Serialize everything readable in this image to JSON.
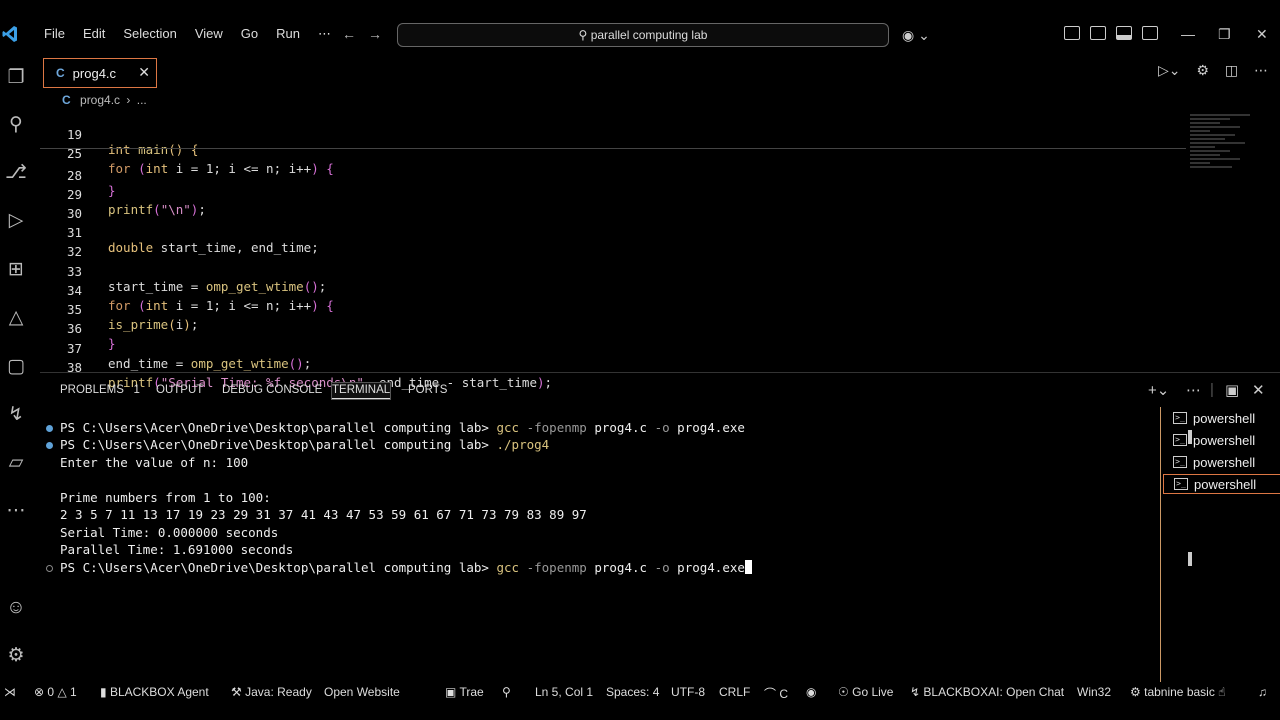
{
  "titlebar": {
    "menus": [
      "File",
      "Edit",
      "Selection",
      "View",
      "Go",
      "Run",
      "⋯"
    ],
    "search": "parallel computing lab",
    "copilot_icon": "copilot-icon"
  },
  "editor": {
    "tab": {
      "lang": "C",
      "name": "prog4.c",
      "close": "✕"
    },
    "breadcrumb": {
      "lang": "C",
      "file": "prog4.c",
      "sep": "›",
      "more": "..."
    },
    "lines": [
      {
        "num": "19",
        "text": "int main() {"
      },
      {
        "num": "25",
        "text": "for (int i = 1; i <= n; i++) {"
      },
      {
        "num": "28",
        "text": "}"
      },
      {
        "num": "29",
        "text": "printf(\"\\n\");"
      },
      {
        "num": "30",
        "text": ""
      },
      {
        "num": "31",
        "text": "double start_time, end_time;"
      },
      {
        "num": "32",
        "text": ""
      },
      {
        "num": "33",
        "text": "start_time = omp_get_wtime();"
      },
      {
        "num": "34",
        "text": "for (int i = 1; i <= n; i++) {"
      },
      {
        "num": "35",
        "text": "is_prime(i);"
      },
      {
        "num": "36",
        "text": "}"
      },
      {
        "num": "37",
        "text": "end_time = omp_get_wtime();"
      },
      {
        "num": "38",
        "text": "printf(\"Serial Time: %f seconds\\n\", end_time - start_time);"
      }
    ]
  },
  "panel": {
    "tabs": [
      "PROBLEMS",
      "OUTPUT",
      "DEBUG CONSOLE",
      "TERMINAL",
      "PORTS"
    ],
    "problems_count": "1",
    "active_tab": "TERMINAL"
  },
  "terminal": {
    "prompt": "PS C:\\Users\\Acer\\OneDrive\\Desktop\\parallel computing lab>",
    "lines": [
      {
        "type": "cmd",
        "cmd": "gcc",
        "flag": "-fopenmp",
        "rest": "prog4.c",
        "flag2": "-o",
        "rest2": "prog4.exe"
      },
      {
        "type": "cmd",
        "cmd": "./prog4"
      },
      {
        "type": "out",
        "text": "Enter the value of n: 100"
      },
      {
        "type": "out",
        "text": ""
      },
      {
        "type": "out",
        "text": "Prime numbers from 1 to 100:"
      },
      {
        "type": "out",
        "text": "2 3 5 7 11 13 17 19 23 29 31 37 41 43 47 53 59 61 67 71 73 79 83 89 97"
      },
      {
        "type": "out",
        "text": "Serial Time: 0.000000 seconds"
      },
      {
        "type": "out",
        "text": "Parallel Time: 1.691000 seconds"
      },
      {
        "type": "cmd",
        "cmd": "gcc",
        "flag": "-fopenmp",
        "rest": "prog4.c",
        "flag2": "-o",
        "rest2": "prog4.exe"
      }
    ],
    "shells": [
      "powershell",
      "powershell",
      "powershell",
      "powershell"
    ]
  },
  "statusbar": {
    "remote": "⋊",
    "errors": "0",
    "warnings": "1",
    "blackbox": "BLACKBOX Agent",
    "java": "Java: Ready",
    "open_website": "Open Website",
    "trae": "Trae",
    "position": "Ln 5, Col 1",
    "spaces": "Spaces: 4",
    "encoding": "UTF-8",
    "eol": "CRLF",
    "language": "C",
    "golive": "Go Live",
    "blackboxai": "BLACKBOXAI: Open Chat",
    "platform": "Win32",
    "tabnine": "tabnine basic"
  }
}
